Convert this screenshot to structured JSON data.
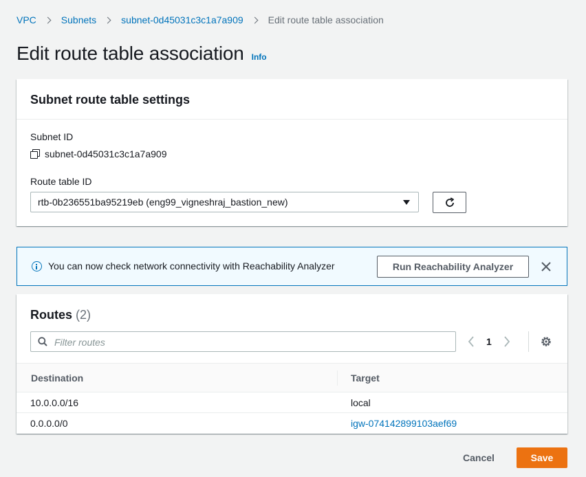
{
  "breadcrumb": {
    "items": [
      "VPC",
      "Subnets",
      "subnet-0d45031c3c1a7a909"
    ],
    "current": "Edit route table association"
  },
  "page": {
    "title": "Edit route table association",
    "info_link": "Info"
  },
  "settings": {
    "header": "Subnet route table settings",
    "subnet_id_label": "Subnet ID",
    "subnet_id_value": "subnet-0d45031c3c1a7a909",
    "route_table_label": "Route table ID",
    "route_table_value": "rtb-0b236551ba95219eb (eng99_vigneshraj_bastion_new)"
  },
  "alert": {
    "message": "You can now check network connectivity with Reachability Analyzer",
    "button_label": "Run Reachability Analyzer"
  },
  "routes": {
    "title": "Routes",
    "count": "(2)",
    "filter_placeholder": "Filter routes",
    "current_page": "1",
    "columns": [
      "Destination",
      "Target"
    ],
    "rows": [
      {
        "destination": "10.0.0.0/16",
        "target": "local",
        "target_is_link": false
      },
      {
        "destination": "0.0.0.0/0",
        "target": "igw-074142899103aef69",
        "target_is_link": true
      }
    ]
  },
  "actions": {
    "cancel_label": "Cancel",
    "save_label": "Save"
  },
  "colors": {
    "link": "#0073bb",
    "primary_button": "#ec7211",
    "alert_background": "#f1faff",
    "page_background": "#f2f3f3"
  },
  "icons": [
    "copy-icon",
    "caret-down-icon",
    "refresh-icon",
    "info-icon",
    "close-icon",
    "search-icon",
    "chevron-left-icon",
    "chevron-right-icon",
    "settings-icon"
  ]
}
